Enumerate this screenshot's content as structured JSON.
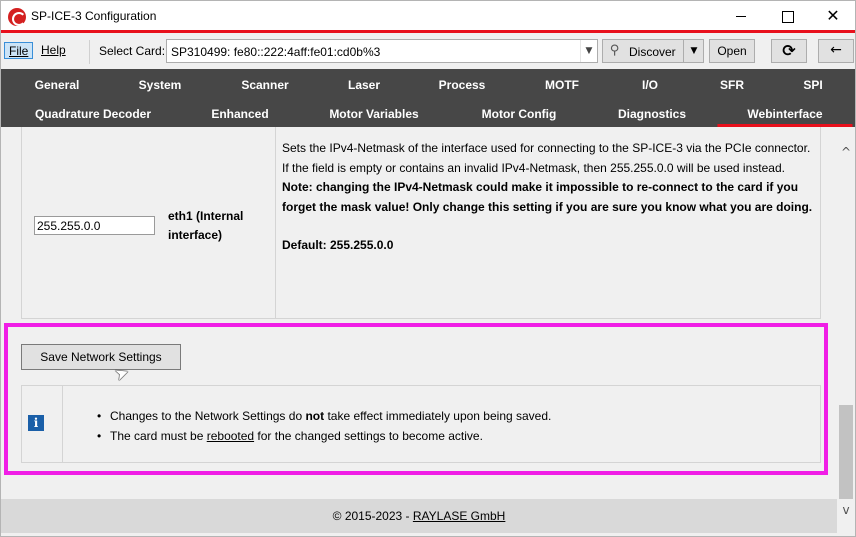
{
  "window": {
    "title": "SP-ICE-3 Configuration",
    "controls": {
      "minimize": "—",
      "maximize": "☐",
      "close": "✕"
    }
  },
  "menu": {
    "file": "File",
    "help": "Help"
  },
  "toolbar": {
    "select_card_label": "Select Card:",
    "card_value": "SP310499: fe80::222:4aff:fe01:cd0b%3",
    "discover_label": "Discover",
    "open_label": "Open",
    "refresh_icon": "⟳",
    "back_icon": "←"
  },
  "tabs": {
    "row1": [
      "General",
      "System",
      "Scanner",
      "Laser",
      "Process",
      "MOTF",
      "I/O",
      "SFR",
      "SPI"
    ],
    "row2": [
      "Quadrature Decoder",
      "Enhanced",
      "Motor Variables",
      "Motor Config",
      "Diagnostics",
      "Webinterface"
    ],
    "active": "Webinterface"
  },
  "netmask": {
    "value": "255.255.0.0",
    "interface_label": "eth1 (Internal interface)",
    "desc_1": "Sets the IPv4-Netmask of the interface used for connecting to the SP-ICE-3 via the PCIe connector.",
    "desc_2": "If the field is empty or contains an invalid IPv4-Netmask, then 255.255.0.0 will be used instead.",
    "warning": "Note: changing the IPv4-Netmask could make it impossible to re-connect to the card if you forget the mask value! Only change this setting if you are sure you know what you are doing.",
    "default": "Default: 255.255.0.0"
  },
  "save_button": "Save Network Settings",
  "info": {
    "icon": "i",
    "item1_pre": "Changes to the Network Settings do ",
    "item1_bold": "not",
    "item1_post": " take effect immediately upon being saved.",
    "item2_pre": "The card must be ",
    "item2_link": "rebooted",
    "item2_post": " for the changed settings to become active."
  },
  "footer": {
    "copyright": "© 2015-2023 - ",
    "company": "RAYLASE GmbH"
  }
}
